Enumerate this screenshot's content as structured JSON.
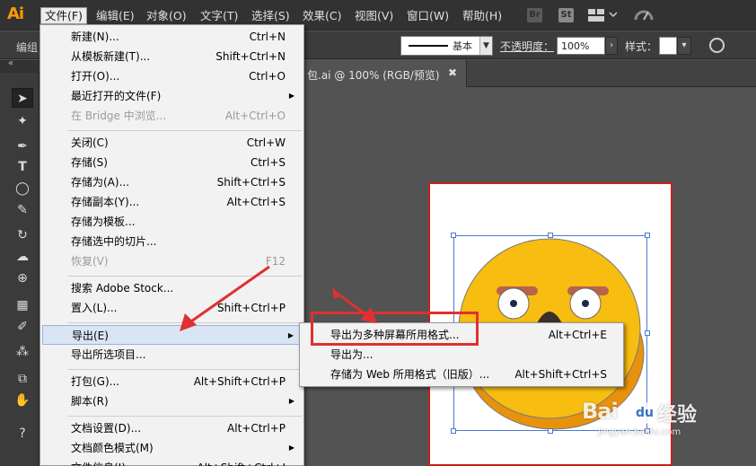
{
  "app": {
    "logo": "Ai"
  },
  "menubar": {
    "items": [
      "文件(F)",
      "编辑(E)",
      "对象(O)",
      "文字(T)",
      "选择(S)",
      "效果(C)",
      "视图(V)",
      "窗口(W)",
      "帮助(H)"
    ],
    "br_icon": "Br",
    "st_icon": "St"
  },
  "controlbar": {
    "group_label": "编组",
    "stroke_style": "基本",
    "opacity_label": "不透明度：",
    "opacity_value": "100%",
    "style_label": "样式："
  },
  "document": {
    "tab_title": "包.ai @ 100% (RGB/预览)",
    "tab_close": "✖"
  },
  "tools": [
    "selection-tool-icon",
    "magic-wand-icon",
    "pen-icon",
    "type-icon",
    "ellipse-icon",
    "brush-icon",
    "rotate-icon",
    "warp-icon",
    "shape-builder-icon",
    "mesh-icon",
    "eyedropper-icon",
    "symbol-sprayer-icon",
    "artboard-icon",
    "hand-icon",
    "help-icon"
  ],
  "file_menu": {
    "items": [
      {
        "label": "新建(N)...",
        "shortcut": "Ctrl+N"
      },
      {
        "label": "从模板新建(T)...",
        "shortcut": "Shift+Ctrl+N"
      },
      {
        "label": "打开(O)...",
        "shortcut": "Ctrl+O"
      },
      {
        "label": "最近打开的文件(F)",
        "shortcut": ""
      },
      {
        "label": "在 Bridge 中浏览...",
        "shortcut": "Alt+Ctrl+O"
      },
      {
        "label": "关闭(C)",
        "shortcut": "Ctrl+W"
      },
      {
        "label": "存储(S)",
        "shortcut": "Ctrl+S"
      },
      {
        "label": "存储为(A)...",
        "shortcut": "Shift+Ctrl+S"
      },
      {
        "label": "存储副本(Y)...",
        "shortcut": "Alt+Ctrl+S"
      },
      {
        "label": "存储为模板...",
        "shortcut": ""
      },
      {
        "label": "存储选中的切片...",
        "shortcut": ""
      },
      {
        "label": "恢复(V)",
        "shortcut": "F12"
      },
      {
        "label": "搜索 Adobe Stock...",
        "shortcut": ""
      },
      {
        "label": "置入(L)...",
        "shortcut": "Shift+Ctrl+P"
      },
      {
        "label": "导出(E)",
        "shortcut": ""
      },
      {
        "label": "导出所选项目...",
        "shortcut": ""
      },
      {
        "label": "打包(G)...",
        "shortcut": "Alt+Shift+Ctrl+P"
      },
      {
        "label": "脚本(R)",
        "shortcut": ""
      },
      {
        "label": "文档设置(D)...",
        "shortcut": "Alt+Ctrl+P"
      },
      {
        "label": "文档颜色模式(M)",
        "shortcut": ""
      },
      {
        "label": "文件信息(I)...",
        "shortcut": "Alt+Shift+Ctrl+I"
      }
    ]
  },
  "export_submenu": {
    "items": [
      {
        "label": "导出为多种屏幕所用格式...",
        "shortcut": "Alt+Ctrl+E"
      },
      {
        "label": "导出为...",
        "shortcut": ""
      },
      {
        "label": "存储为 Web 所用格式（旧版）...",
        "shortcut": "Alt+Shift+Ctrl+S"
      }
    ]
  },
  "watermark": {
    "brand": "Bai",
    "paw": "du",
    "suffix": "经验",
    "url": "jingyan.baidu.com"
  },
  "colors": {
    "accent": "#ff9a00",
    "annotation": "#e03030",
    "selection": "#4a7ad1"
  }
}
